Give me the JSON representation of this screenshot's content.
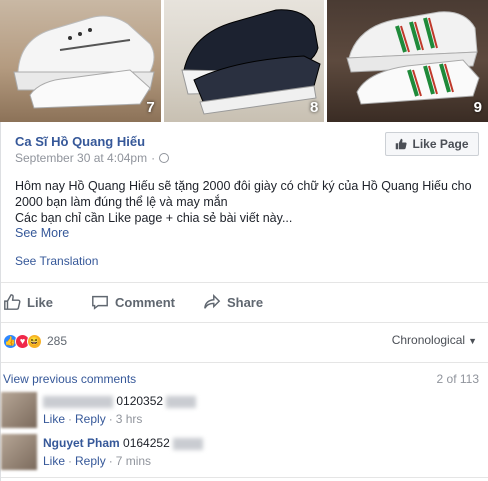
{
  "photos": [
    {
      "number": "7"
    },
    {
      "number": "8"
    },
    {
      "number": "9"
    }
  ],
  "post": {
    "author": "Ca Sĩ Hồ Quang Hiếu",
    "date": "September 30 at 4:04pm",
    "like_page_label": "Like Page",
    "text_line1": "Hôm nay Hồ Quang Hiếu sẽ tặng 2000 đôi giày có chữ ký của Hồ Quang Hiếu cho",
    "text_line2": "2000 bạn làm đúng thể lệ và may mắn",
    "text_line3": "Các bạn chỉ cần Like page + chia sẻ bài viết này...",
    "see_more": "See More",
    "see_translation": "See Translation"
  },
  "actions": {
    "like": "Like",
    "comment": "Comment",
    "share": "Share"
  },
  "reactions": {
    "count": "285",
    "sort_label": "Chronological"
  },
  "comments_header": {
    "view_previous": "View previous comments",
    "count": "2 of 113"
  },
  "comments": [
    {
      "name": "",
      "text": "0120352",
      "like": "Like",
      "reply": "Reply",
      "time": "3 hrs"
    },
    {
      "name": "Nguyet Pham",
      "text": "0164252",
      "like": "Like",
      "reply": "Reply",
      "time": "7 mins"
    }
  ],
  "colors": {
    "link": "#365899",
    "muted": "#90949c",
    "like_blue": "#2d88ff",
    "love_red": "#f0284a",
    "haha_yellow": "#f7b125"
  }
}
